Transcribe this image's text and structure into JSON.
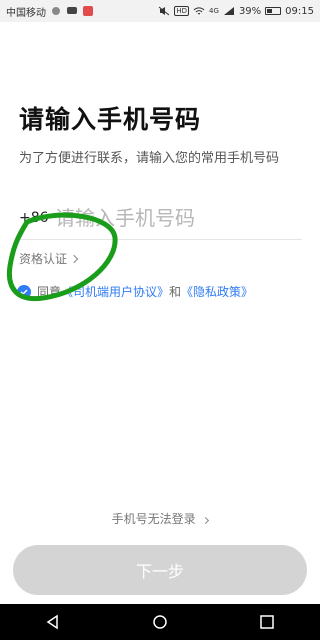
{
  "status_bar": {
    "carrier": "中国移动",
    "network": "4G",
    "battery": "39%",
    "time": "09:15"
  },
  "page": {
    "title": "请输入手机号码",
    "subtitle": "为了方便进行联系，请输入您的常用手机号码",
    "country_code": "+86",
    "phone_placeholder": "请输入手机号码",
    "qualification_label": "资格认证",
    "agreement_prefix": "同意",
    "user_agreement_link": "《司机端用户协议》",
    "agreement_and": "和",
    "privacy_link": "《隐私政策》",
    "alt_login_label": "手机号无法登录",
    "next_button_label": "下一步"
  },
  "colors": {
    "accent": "#2f7cf6",
    "button_disabled": "#d4d4d4",
    "annotation_green": "#1a9d1a"
  }
}
